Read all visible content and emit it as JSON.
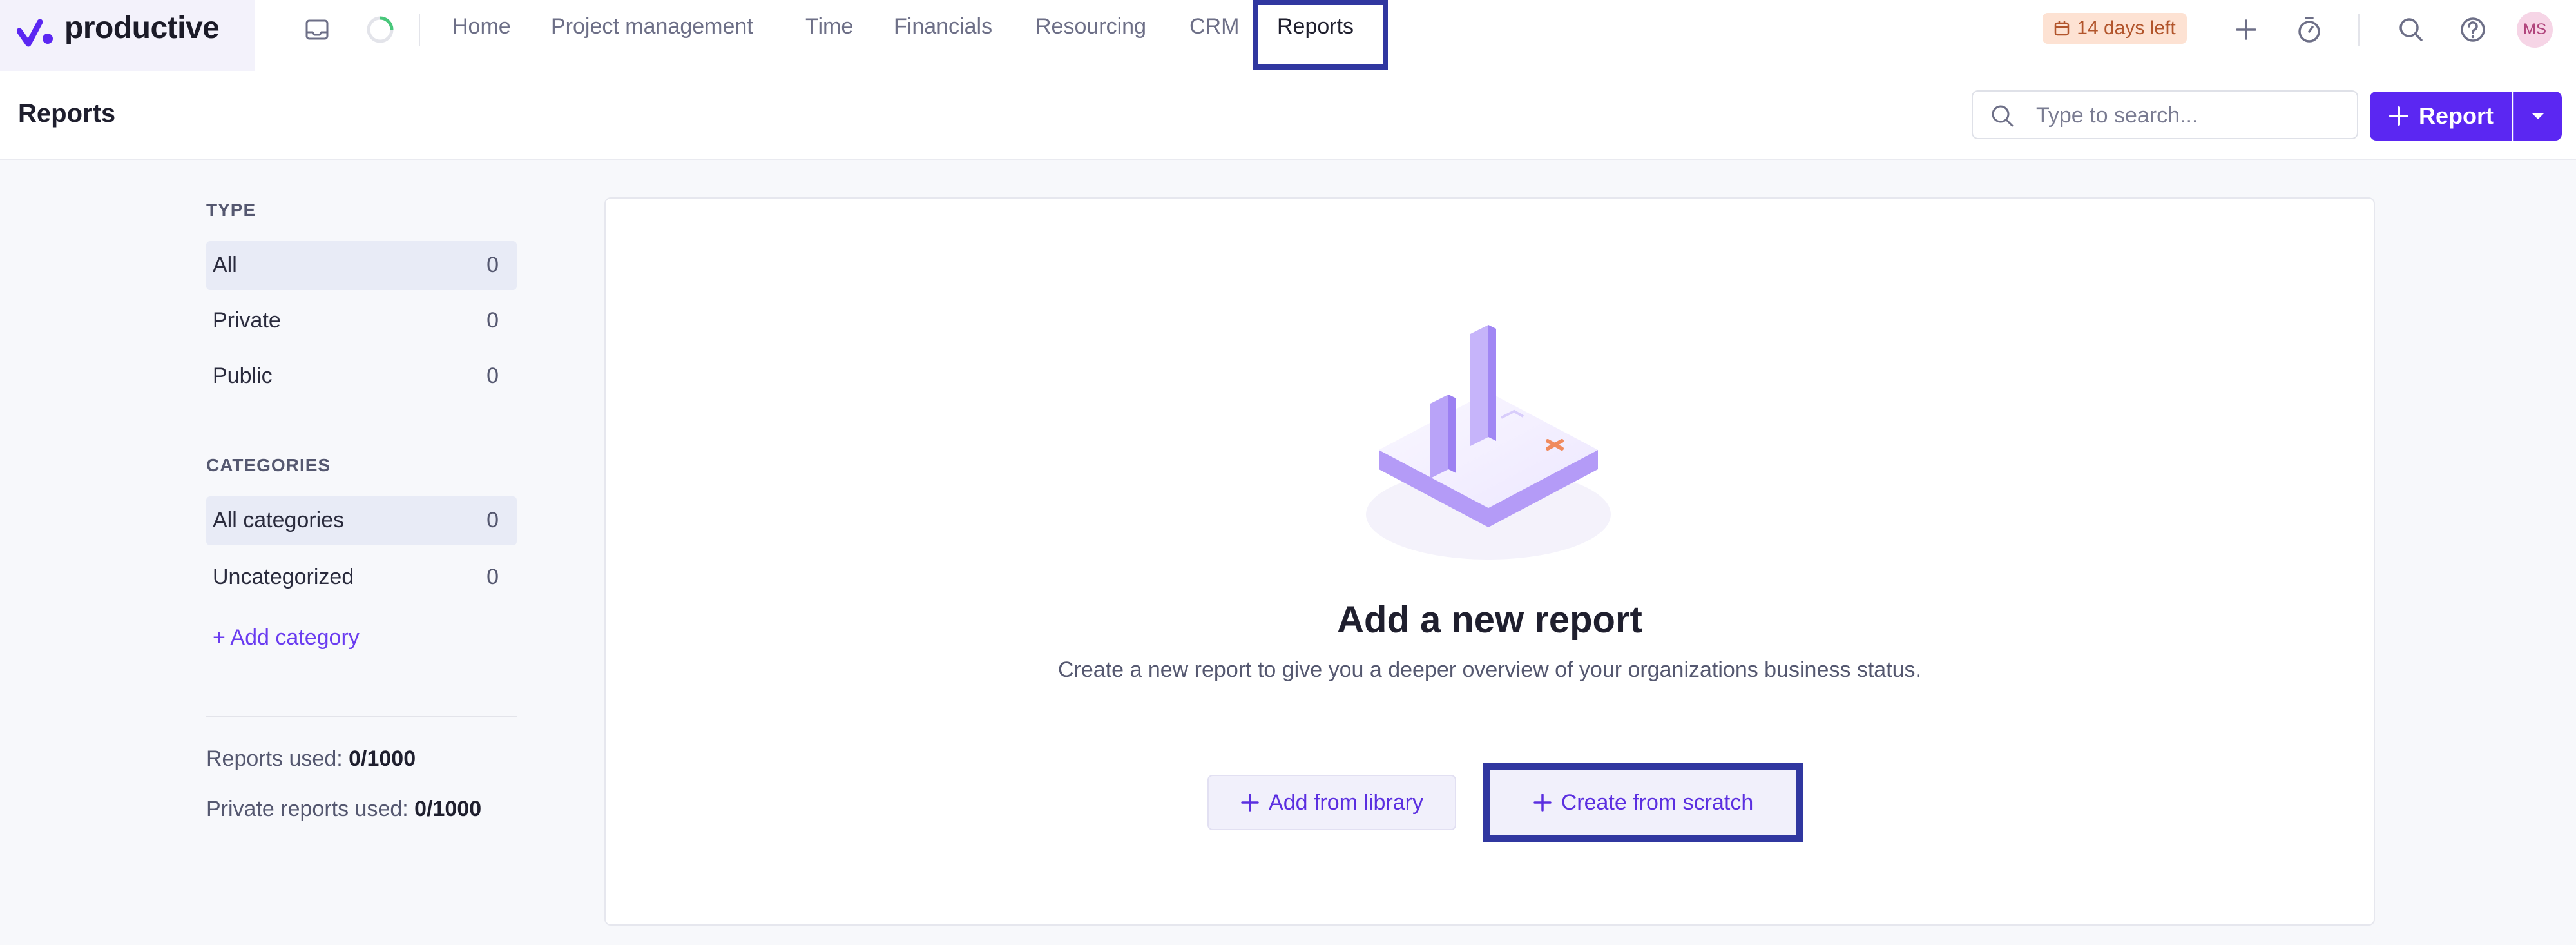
{
  "brand": {
    "name": "productive",
    "accent": "#5b27f2"
  },
  "nav": {
    "links": [
      "Home",
      "Project management",
      "Time",
      "Financials",
      "Resourcing",
      "CRM",
      "Reports"
    ],
    "active": "Reports",
    "trial_badge": "14 days left",
    "avatar_initials": "MS"
  },
  "header": {
    "title": "Reports",
    "search_placeholder": "Type to search...",
    "report_button": "Report"
  },
  "sidebar": {
    "type_label": "TYPE",
    "types": [
      {
        "label": "All",
        "count": "0"
      },
      {
        "label": "Private",
        "count": "0"
      },
      {
        "label": "Public",
        "count": "0"
      }
    ],
    "categories_label": "CATEGORIES",
    "categories": [
      {
        "label": "All categories",
        "count": "0"
      },
      {
        "label": "Uncategorized",
        "count": "0"
      }
    ],
    "add_category": "+ Add category",
    "reports_used_label": "Reports used:",
    "reports_used_value": "0/1000",
    "private_used_label": "Private reports used:",
    "private_used_value": "0/1000"
  },
  "empty_state": {
    "title": "Add a new report",
    "subtitle": "Create a new report to give you a deeper overview of your organizations business status.",
    "add_from_library": "Add from library",
    "create_from_scratch": "Create from scratch"
  }
}
